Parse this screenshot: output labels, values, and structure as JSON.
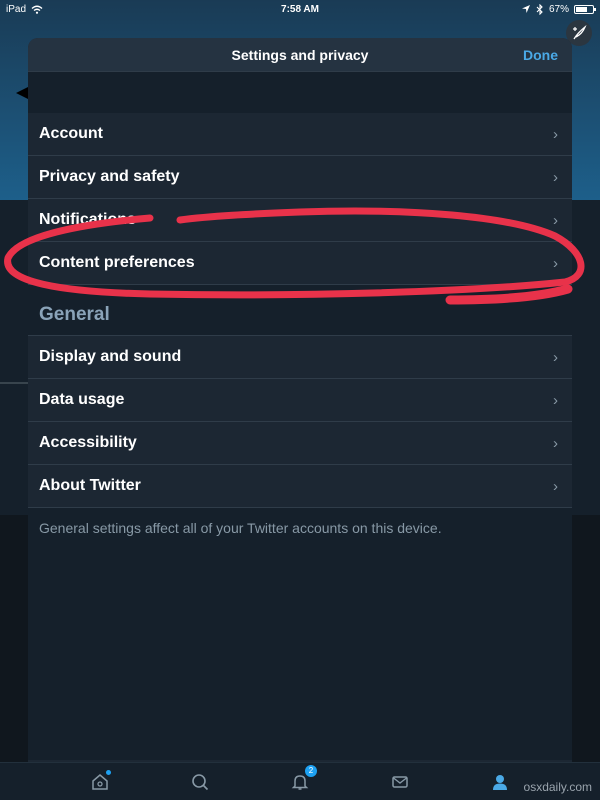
{
  "status_bar": {
    "device": "iPad",
    "time": "7:58 AM",
    "battery": "67%",
    "battery_level": 0.67
  },
  "modal": {
    "title": "Settings and privacy",
    "done_label": "Done",
    "account_rows": [
      {
        "label": "Account"
      },
      {
        "label": "Privacy and safety"
      },
      {
        "label": "Notifications"
      },
      {
        "label": "Content preferences"
      }
    ],
    "general": {
      "title": "General",
      "rows": [
        {
          "label": "Display and sound"
        },
        {
          "label": "Data usage"
        },
        {
          "label": "Accessibility"
        },
        {
          "label": "About Twitter"
        }
      ],
      "note": "General settings affect all of your Twitter accounts on this device."
    }
  },
  "tab_bar": {
    "tabs": [
      "home-icon",
      "search-icon",
      "notifications-icon",
      "messages-icon",
      "profile-icon"
    ],
    "notification_count": "2"
  },
  "watermark": "osxdaily.com",
  "colors": {
    "accent": "#4aa9e6",
    "highlight_stroke": "#e8324a",
    "background": "#15202b",
    "row_background": "#1c2733"
  }
}
